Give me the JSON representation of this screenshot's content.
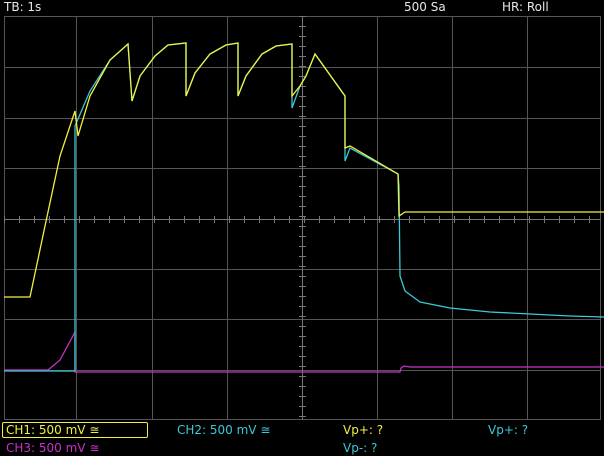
{
  "header": {
    "timebase": "TB: 1s",
    "sample_rate": "500 Sa",
    "acquisition_mode": "HR: Roll"
  },
  "channels": [
    {
      "label": "CH1: 500 mV ≅",
      "color": "#f2f040",
      "selected": true
    },
    {
      "label": "CH2: 500 mV ≅",
      "color": "#3cc8d8"
    },
    {
      "label": "CH3: 500 mV ≅",
      "color": "#c832c8"
    }
  ],
  "measurements": [
    {
      "label": "Vp+: ?",
      "color": "#f2f040"
    },
    {
      "label": "Vp-: ?",
      "color": "#3cc8d8"
    },
    {
      "label": "Vp+: ?",
      "color": "#3cc8d8"
    }
  ],
  "colors": {
    "background": "#000000",
    "grid": "#5a5a5a",
    "ch1": "#f2f040",
    "ch2": "#3cc8d8",
    "ch3": "#c832c8"
  }
}
